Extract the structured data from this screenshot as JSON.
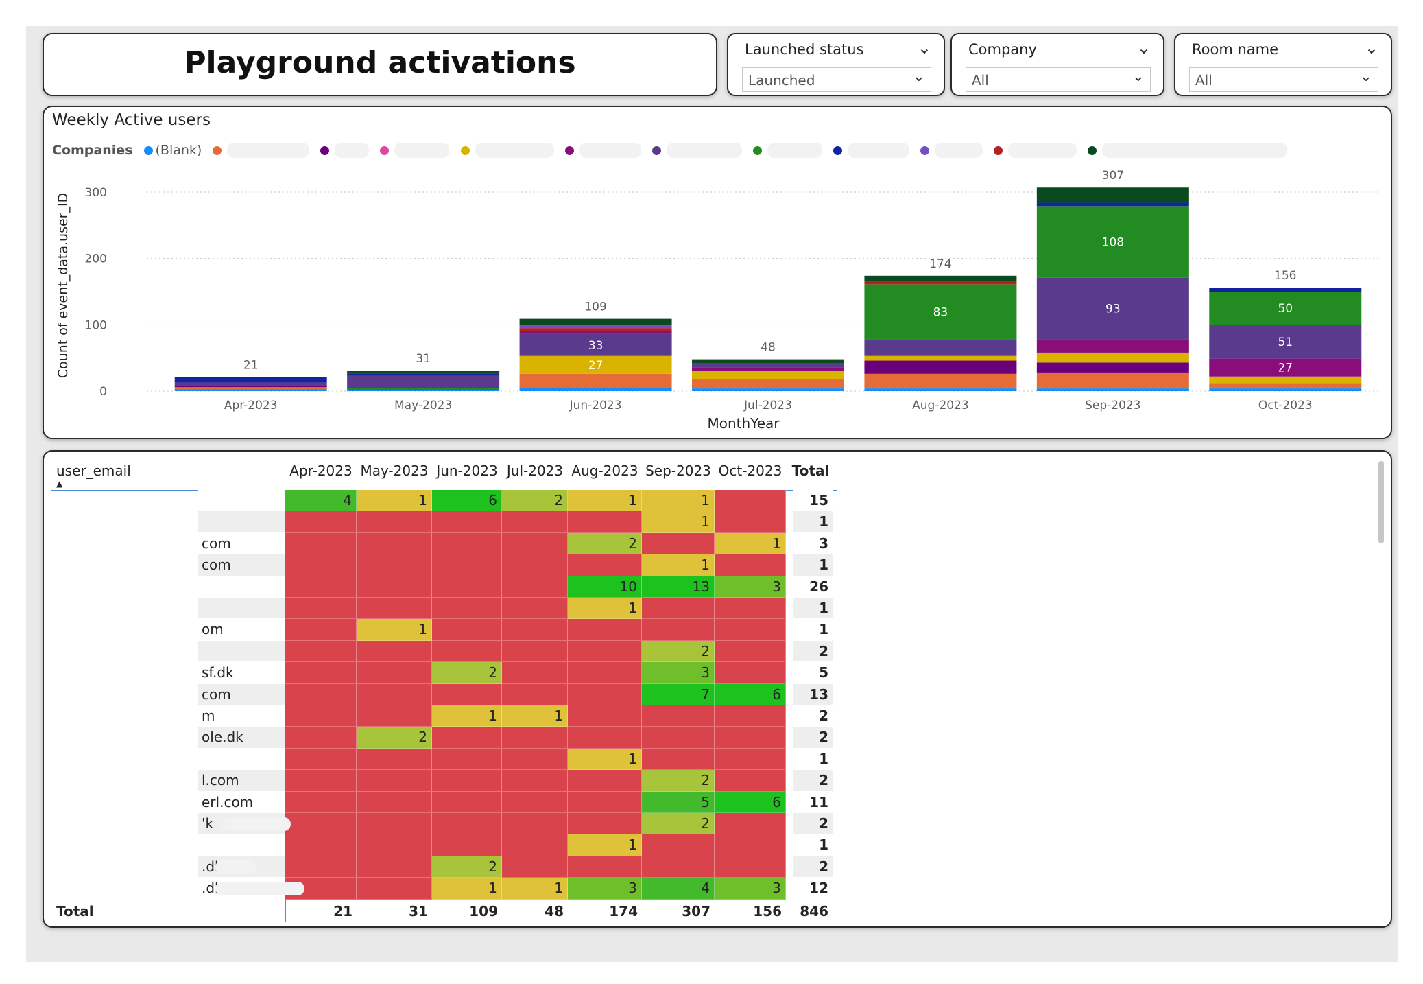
{
  "title": "Playground activations",
  "slicers": [
    {
      "label": "Launched status",
      "value": "Launched"
    },
    {
      "label": "Company",
      "value": "All"
    },
    {
      "label": "Room name",
      "value": "All"
    }
  ],
  "chart": {
    "title": "Weekly Active users",
    "legend_title": "Companies",
    "legend_first": "(Blank)"
  },
  "chart_data": {
    "type": "bar",
    "stacked": true,
    "categories": [
      "Apr-2023",
      "May-2023",
      "Jun-2023",
      "Jul-2023",
      "Aug-2023",
      "Sep-2023",
      "Oct-2023"
    ],
    "totals": [
      21,
      31,
      109,
      48,
      174,
      307,
      156
    ],
    "xlabel": "MonthYear",
    "ylabel": "Count of event_data.user_ID",
    "ylim": [
      0,
      320
    ],
    "yticks": [
      0,
      100,
      200,
      300
    ],
    "grid": true,
    "legend_position": "top",
    "series_colors": [
      "#118dff",
      "#e66c37",
      "#6b007b",
      "#e044a7",
      "#d9b300",
      "#8a0e7a",
      "#5a3a8c",
      "#228b22",
      "#12239e",
      "#744ec2",
      "#b22222",
      "#0b4a1f"
    ],
    "segments": [
      [
        {
          "v": 3,
          "c": "#118dff"
        },
        {
          "v": 3,
          "c": "#e66c37"
        },
        {
          "v": 3,
          "c": "#6b007b"
        },
        {
          "v": 4,
          "c": "#5a3a8c"
        },
        {
          "v": 8,
          "c": "#12239e"
        }
      ],
      [
        {
          "v": 2,
          "c": "#118dff"
        },
        {
          "v": 3,
          "c": "#228b22"
        },
        {
          "v": 18,
          "c": "#5a3a8c"
        },
        {
          "v": 3,
          "c": "#12239e"
        },
        {
          "v": 5,
          "c": "#0b4a1f"
        }
      ],
      [
        {
          "v": 6,
          "c": "#118dff"
        },
        {
          "v": 20,
          "c": "#e66c37"
        },
        {
          "v": 27,
          "c": "#d9b300",
          "label": "27"
        },
        {
          "v": 33,
          "c": "#5a3a8c",
          "label": "33"
        },
        {
          "v": 5,
          "c": "#8a0e7a"
        },
        {
          "v": 4,
          "c": "#b22222"
        },
        {
          "v": 4,
          "c": "#744ec2"
        },
        {
          "v": 10,
          "c": "#0b4a1f"
        }
      ],
      [
        {
          "v": 4,
          "c": "#118dff"
        },
        {
          "v": 14,
          "c": "#e66c37"
        },
        {
          "v": 12,
          "c": "#d9b300"
        },
        {
          "v": 6,
          "c": "#8a0e7a"
        },
        {
          "v": 6,
          "c": "#5a3a8c"
        },
        {
          "v": 6,
          "c": "#0b4a1f"
        }
      ],
      [
        {
          "v": 4,
          "c": "#118dff"
        },
        {
          "v": 22,
          "c": "#e66c37"
        },
        {
          "v": 20,
          "c": "#6b007b"
        },
        {
          "v": 7,
          "c": "#d9b300"
        },
        {
          "v": 25,
          "c": "#5a3a8c"
        },
        {
          "v": 83,
          "c": "#228b22",
          "label": "83"
        },
        {
          "v": 5,
          "c": "#b22222"
        },
        {
          "v": 8,
          "c": "#0b4a1f"
        }
      ],
      [
        {
          "v": 4,
          "c": "#118dff"
        },
        {
          "v": 24,
          "c": "#e66c37"
        },
        {
          "v": 15,
          "c": "#6b007b"
        },
        {
          "v": 15,
          "c": "#d9b300"
        },
        {
          "v": 20,
          "c": "#8a0e7a"
        },
        {
          "v": 93,
          "c": "#5a3a8c",
          "label": "93"
        },
        {
          "v": 108,
          "c": "#228b22",
          "label": "108"
        },
        {
          "v": 5,
          "c": "#12239e"
        },
        {
          "v": 23,
          "c": "#0b4a1f"
        }
      ],
      [
        {
          "v": 4,
          "c": "#118dff"
        },
        {
          "v": 8,
          "c": "#e66c37"
        },
        {
          "v": 10,
          "c": "#d9b300"
        },
        {
          "v": 27,
          "c": "#8a0e7a",
          "label": "27"
        },
        {
          "v": 51,
          "c": "#5a3a8c",
          "label": "51"
        },
        {
          "v": 50,
          "c": "#228b22",
          "label": "50"
        },
        {
          "v": 6,
          "c": "#12239e"
        }
      ]
    ]
  },
  "matrix": {
    "row_header": "user_email",
    "columns": [
      "Apr-2023",
      "May-2023",
      "Jun-2023",
      "Jul-2023",
      "Aug-2023",
      "Sep-2023",
      "Oct-2023"
    ],
    "total_header": "Total",
    "rows": [
      {
        "label": "",
        "values": [
          4,
          1,
          6,
          2,
          1,
          1,
          null
        ],
        "total": 15
      },
      {
        "label": "",
        "values": [
          null,
          null,
          null,
          null,
          null,
          1,
          null
        ],
        "total": 1
      },
      {
        "label": "com",
        "values": [
          null,
          null,
          null,
          null,
          2,
          null,
          1
        ],
        "total": 3
      },
      {
        "label": "com",
        "values": [
          null,
          null,
          null,
          null,
          null,
          1,
          null
        ],
        "total": 1
      },
      {
        "label": "",
        "values": [
          null,
          null,
          null,
          null,
          10,
          13,
          3
        ],
        "total": 26
      },
      {
        "label": "",
        "values": [
          null,
          null,
          null,
          null,
          1,
          null,
          null
        ],
        "total": 1
      },
      {
        "label": "om",
        "values": [
          null,
          1,
          null,
          null,
          null,
          null,
          null
        ],
        "total": 1
      },
      {
        "label": "",
        "values": [
          null,
          null,
          null,
          null,
          null,
          2,
          null
        ],
        "total": 2
      },
      {
        "label": "sf.dk",
        "values": [
          null,
          null,
          2,
          null,
          null,
          3,
          null
        ],
        "total": 5
      },
      {
        "label": "com",
        "values": [
          null,
          null,
          null,
          null,
          null,
          7,
          6
        ],
        "total": 13
      },
      {
        "label": "m",
        "values": [
          null,
          null,
          1,
          1,
          null,
          null,
          null
        ],
        "total": 2
      },
      {
        "label": "ole.dk",
        "values": [
          null,
          2,
          null,
          null,
          null,
          null,
          null
        ],
        "total": 2
      },
      {
        "label": "",
        "values": [
          null,
          null,
          null,
          null,
          1,
          null,
          null
        ],
        "total": 1
      },
      {
        "label": "l.com",
        "values": [
          null,
          null,
          null,
          null,
          null,
          2,
          null
        ],
        "total": 2
      },
      {
        "label": "erl.com",
        "values": [
          null,
          null,
          null,
          null,
          null,
          5,
          6
        ],
        "total": 11
      },
      {
        "label": "'k",
        "values": [
          null,
          null,
          null,
          null,
          null,
          2,
          null
        ],
        "total": 2
      },
      {
        "label": "",
        "values": [
          null,
          null,
          null,
          null,
          1,
          null,
          null
        ],
        "total": 1
      },
      {
        "label": ".dk",
        "values": [
          null,
          null,
          2,
          null,
          null,
          null,
          null
        ],
        "total": 2
      },
      {
        "label": ".dk",
        "values": [
          null,
          null,
          1,
          1,
          3,
          4,
          3
        ],
        "total": 12
      }
    ],
    "total_label": "Total",
    "column_totals": [
      21,
      31,
      109,
      48,
      174,
      307,
      156
    ],
    "grand_total": 846
  }
}
